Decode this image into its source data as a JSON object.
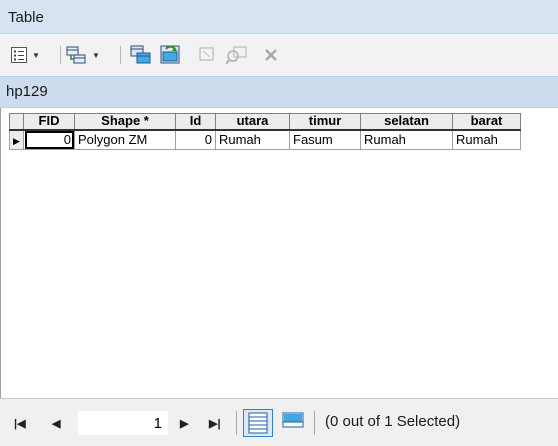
{
  "window": {
    "title": "Table"
  },
  "toolbar": {
    "items": [
      "table-options-icon",
      "related-tables-icon",
      "select-by-attributes-icon",
      "switch-selection-icon",
      "clear-selection-icon",
      "zoom-to-selected-icon",
      "delete-selected-icon"
    ]
  },
  "layer": {
    "name": "hp129"
  },
  "table": {
    "columns": [
      "FID",
      "Shape *",
      "Id",
      "utara",
      "timur",
      "selatan",
      "barat"
    ],
    "rows": [
      {
        "fid": "0",
        "shape": "Polygon ZM",
        "id": "0",
        "utara": "Rumah",
        "timur": "Fasum",
        "selatan": "Rumah",
        "barat": "Rumah"
      }
    ]
  },
  "status": {
    "record": "1",
    "selection_text": "(0 out of 1 Selected)"
  },
  "colors": {
    "title_bg": "#d7e3f2",
    "layer_bg": "#cddcee",
    "accent": "#2a7fd4"
  }
}
